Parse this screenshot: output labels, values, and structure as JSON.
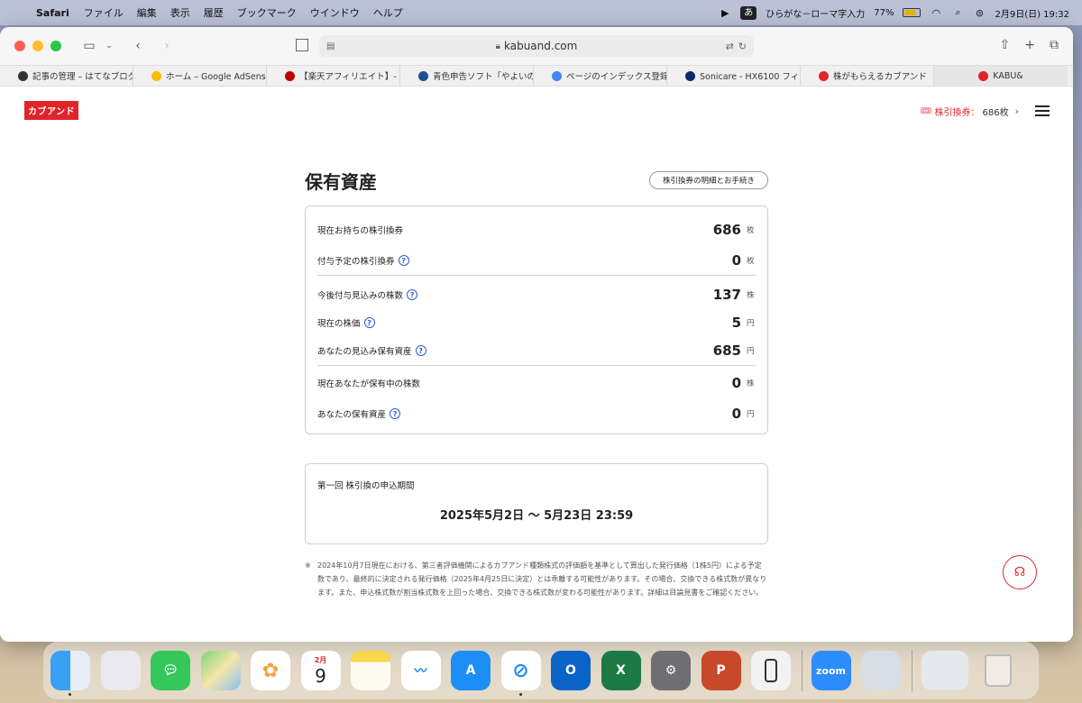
{
  "menubar": {
    "app_name": "Safari",
    "items": [
      "ファイル",
      "編集",
      "表示",
      "履歴",
      "ブックマーク",
      "ウインドウ",
      "ヘルプ"
    ],
    "ime_badge": "あ",
    "ime_label": "ひらがな－ローマ字入力",
    "battery": "77%",
    "battery_level": 0.77,
    "datetime": "2月9日(日)  19:32"
  },
  "browser": {
    "url": "kabuand.com",
    "bookmarks": [
      {
        "label": "記事の管理 – はてなブログ",
        "color": "#333333"
      },
      {
        "label": "ホーム – Google AdSense",
        "color": "#fbbc04"
      },
      {
        "label": "【楽天アフィリエイト】- レ…",
        "color": "#bf0000"
      },
      {
        "label": "青色申告ソフト「やよいの…",
        "color": "#1d4f91"
      },
      {
        "label": "ページのインデックス登録",
        "color": "#4285f4"
      },
      {
        "label": "Sonicare - HX6100 フィ…",
        "color": "#0b2a6b"
      },
      {
        "label": "株がもらえるカブアンド",
        "color": "#e0242a"
      }
    ],
    "last_tab": "KABU&"
  },
  "site": {
    "logo": "カブアンド",
    "coupon_label": "株引換券：",
    "coupon_value": "686枚",
    "page_title": "保有資産",
    "detail_button": "株引換券の明細とお手続き",
    "rows": [
      {
        "label": "現在お持ちの株引換券",
        "value": "686",
        "unit": "枚",
        "help": false
      },
      {
        "label": "付与予定の株引換券",
        "value": "0",
        "unit": "枚",
        "help": true
      },
      {
        "label": "今後付与見込みの株数",
        "value": "137",
        "unit": "株",
        "help": true
      },
      {
        "label": "現在の株価",
        "value": "5",
        "unit": "円",
        "help": true
      },
      {
        "label": "あなたの見込み保有資産",
        "value": "685",
        "unit": "円",
        "help": true
      },
      {
        "label": "現在あなたが保有中の株数",
        "value": "0",
        "unit": "株",
        "help": false
      },
      {
        "label": "あなたの保有資産",
        "value": "0",
        "unit": "円",
        "help": true
      }
    ],
    "period_label": "第一回 株引換の申込期間",
    "period_value": "2025年5月2日 〜 5月23日 23:59",
    "note_mark": "※",
    "note": "2024年10月7日現在における、第三者評価機関によるカブアンド種類株式の評価額を基準として算出した発行価格（1株5円）による予定数であり、最終的に決定される発行価格（2025年4月25日に決定）とは乖離する可能性があります。その場合、交換できる株式数が異なります。また、申込株式数が割当株式数を上回った場合、交換できる株式数が変わる可能性があります。詳細は目論見書をご確認ください。"
  },
  "dock": {
    "calendar_month": "2月",
    "calendar_day": "9",
    "zoom_label": "zoom",
    "apps": [
      "Finder",
      "Launchpad",
      "Messages",
      "Maps",
      "Photos",
      "Calendar",
      "Notes",
      "Freeform",
      "App Store",
      "Safari",
      "Outlook",
      "Excel",
      "System Settings",
      "PowerPoint",
      "iPhone Mirroring",
      "Zoom",
      "Preview",
      "Downloads",
      "Trash"
    ]
  }
}
